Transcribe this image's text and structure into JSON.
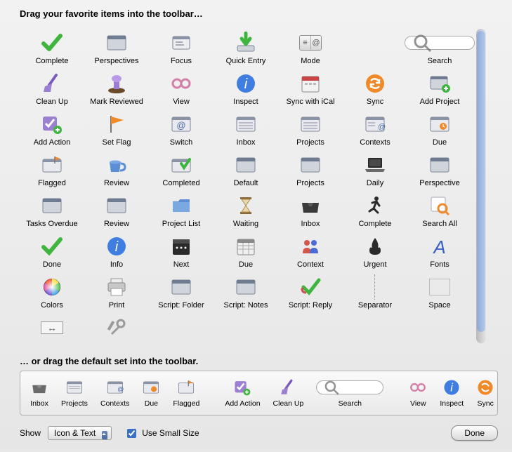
{
  "instr_top": "Drag your favorite items into the toolbar…",
  "instr_bottom": "… or drag the default set into the toolbar.",
  "show_label": "Show",
  "select_value": "Icon & Text",
  "use_small": "Use Small Size",
  "done": "Done",
  "items": [
    {
      "l": "Complete"
    },
    {
      "l": "Perspectives"
    },
    {
      "l": "Focus"
    },
    {
      "l": "Quick Entry"
    },
    {
      "l": "Mode"
    },
    {
      "l": ""
    },
    {
      "l": "Search"
    },
    {
      "l": "Clean Up"
    },
    {
      "l": "Mark Reviewed"
    },
    {
      "l": "View"
    },
    {
      "l": "Inspect"
    },
    {
      "l": "Sync with iCal"
    },
    {
      "l": "Sync"
    },
    {
      "l": "Add Project"
    },
    {
      "l": "Add Action"
    },
    {
      "l": "Set Flag"
    },
    {
      "l": "Switch"
    },
    {
      "l": "Inbox"
    },
    {
      "l": "Projects"
    },
    {
      "l": "Contexts"
    },
    {
      "l": "Due"
    },
    {
      "l": "Flagged"
    },
    {
      "l": "Review"
    },
    {
      "l": "Completed"
    },
    {
      "l": "Default"
    },
    {
      "l": "Projects"
    },
    {
      "l": "Daily"
    },
    {
      "l": "Perspective"
    },
    {
      "l": "Tasks Overdue"
    },
    {
      "l": "Review"
    },
    {
      "l": "Project List"
    },
    {
      "l": "Waiting"
    },
    {
      "l": "Inbox"
    },
    {
      "l": "Complete"
    },
    {
      "l": "Search All"
    },
    {
      "l": "Done"
    },
    {
      "l": "Info"
    },
    {
      "l": "Next"
    },
    {
      "l": "Due"
    },
    {
      "l": "Context"
    },
    {
      "l": "Urgent"
    },
    {
      "l": "Fonts"
    },
    {
      "l": "Colors"
    },
    {
      "l": "Print"
    },
    {
      "l": "Script: Folder"
    },
    {
      "l": "Script: Notes"
    },
    {
      "l": "Script: Reply"
    },
    {
      "l": "Separator"
    },
    {
      "l": "Space"
    }
  ],
  "trailing": {
    "l": ""
  },
  "defaults": [
    {
      "l": "Inbox"
    },
    {
      "l": "Projects"
    },
    {
      "l": "Contexts"
    },
    {
      "l": "Due"
    },
    {
      "l": "Flagged"
    },
    {
      "l": "Add Action"
    },
    {
      "l": "Clean Up"
    },
    {
      "l": "Search"
    },
    {
      "l": "View"
    },
    {
      "l": "Inspect"
    },
    {
      "l": "Sync"
    }
  ]
}
